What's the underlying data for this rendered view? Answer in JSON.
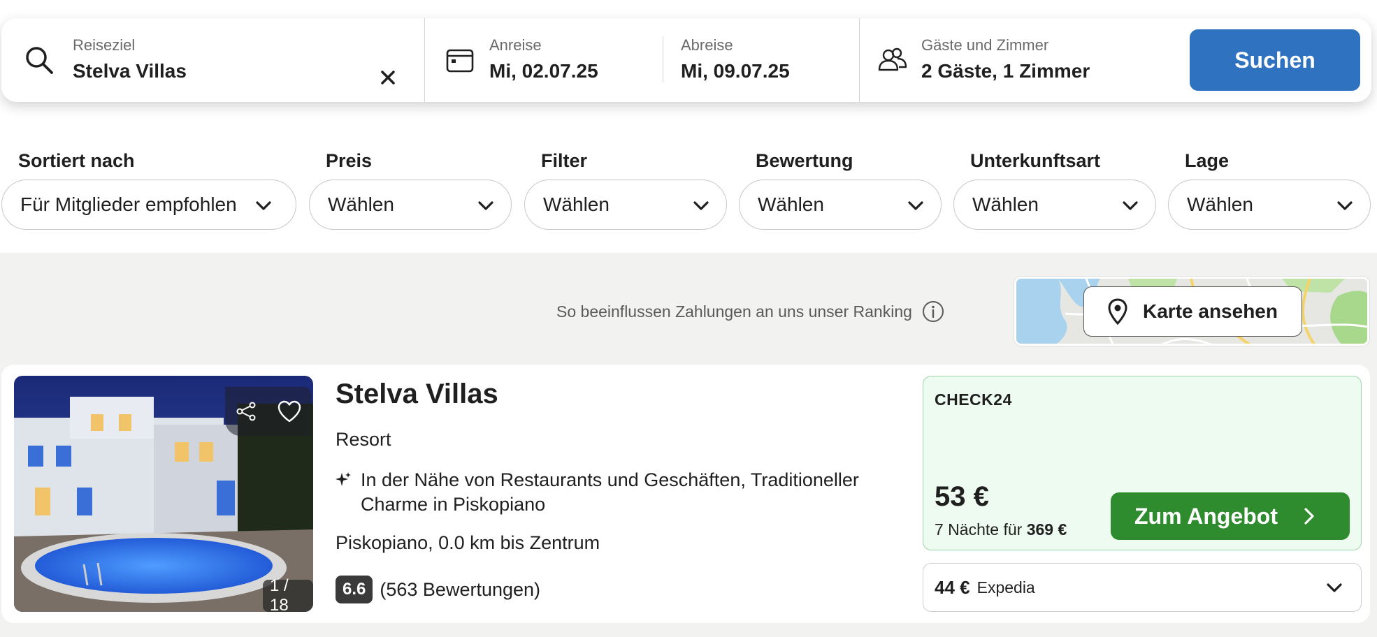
{
  "search": {
    "destination_label": "Reiseziel",
    "destination_value": "Stelva Villas",
    "checkin_label": "Anreise",
    "checkin_value": "Mi, 02.07.25",
    "checkout_label": "Abreise",
    "checkout_value": "Mi, 09.07.25",
    "guests_label": "Gäste und Zimmer",
    "guests_value": "2 Gäste, 1 Zimmer",
    "search_button": "Suchen"
  },
  "filters": [
    {
      "label": "Sortiert nach",
      "value": "Für Mitglieder empfohlen"
    },
    {
      "label": "Preis",
      "value": "Wählen"
    },
    {
      "label": "Filter",
      "value": "Wählen"
    },
    {
      "label": "Bewertung",
      "value": "Wählen"
    },
    {
      "label": "Unterkunftsart",
      "value": "Wählen"
    },
    {
      "label": "Lage",
      "value": "Wählen"
    }
  ],
  "ranking_info": "So beeinflussen Zahlungen an uns unser Ranking",
  "map_button": "Karte ansehen",
  "result": {
    "name": "Stelva Villas",
    "type": "Resort",
    "features": "In der Nähe von Restaurants und Geschäften, Traditioneller Charme in Piskopiano",
    "location": "Piskopiano, 0.0 km bis Zentrum",
    "rating_score": "6.6",
    "rating_count": "(563 Bewertungen)",
    "photo_counter": "1 / 18",
    "offer": {
      "provider": "CHECK24",
      "price": "53 €",
      "nights_prefix": "7 Nächte für",
      "nights_total": "369 €",
      "button": "Zum Angebot"
    },
    "alt_offer": {
      "price": "44 €",
      "provider": "Expedia"
    }
  },
  "colors": {
    "primary_blue": "#2f73c0",
    "offer_green": "#2e8b2e",
    "offer_bg": "#eefbf0",
    "page_bg": "#f2f2f0"
  }
}
